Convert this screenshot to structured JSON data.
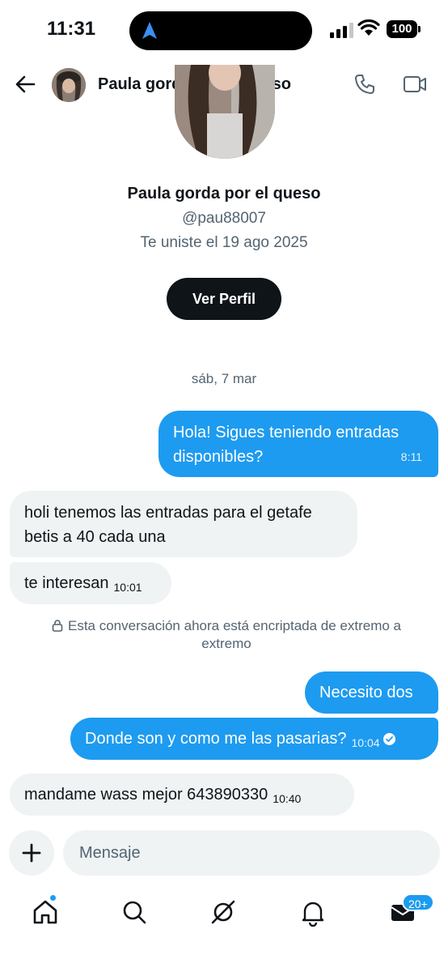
{
  "status_bar": {
    "time": "11:31",
    "battery": "100"
  },
  "header": {
    "title": "Paula gorda por el queso"
  },
  "profile": {
    "name": "Paula gorda por el queso",
    "handle": "@pau88007",
    "joined": "Te uniste el 19 ago 2025",
    "view_profile_label": "Ver Perfil"
  },
  "conversation": {
    "date_separator": "sáb, 7 mar",
    "encryption_notice": "Esta conversación ahora está encriptada de extremo a extremo",
    "messages": [
      {
        "direction": "sent",
        "text": "Hola! Sigues teniendo entradas disponibles?",
        "time": "8:11"
      },
      {
        "direction": "received",
        "text": "holi tenemos las entradas para el getafe betis a 40 cada una",
        "time": ""
      },
      {
        "direction": "received",
        "text": "te interesan",
        "time": "10:01"
      },
      {
        "direction": "sent",
        "text": "Necesito dos",
        "time": ""
      },
      {
        "direction": "sent",
        "text": "Donde son y como me las pasarias?",
        "time": "10:04",
        "status": "read"
      },
      {
        "direction": "received",
        "text": "mandame wass mejor 643890330",
        "time": "10:40"
      }
    ]
  },
  "composer": {
    "placeholder": "Mensaje"
  },
  "tabbar": {
    "items": [
      "home-icon",
      "search-icon",
      "grok-icon",
      "notifications-icon",
      "messages-icon"
    ],
    "messages_badge": "20+"
  },
  "colors": {
    "accent": "#1d9bf0",
    "bubble_received": "#eff3f4",
    "text_primary": "#0f1419",
    "text_secondary": "#536471"
  }
}
